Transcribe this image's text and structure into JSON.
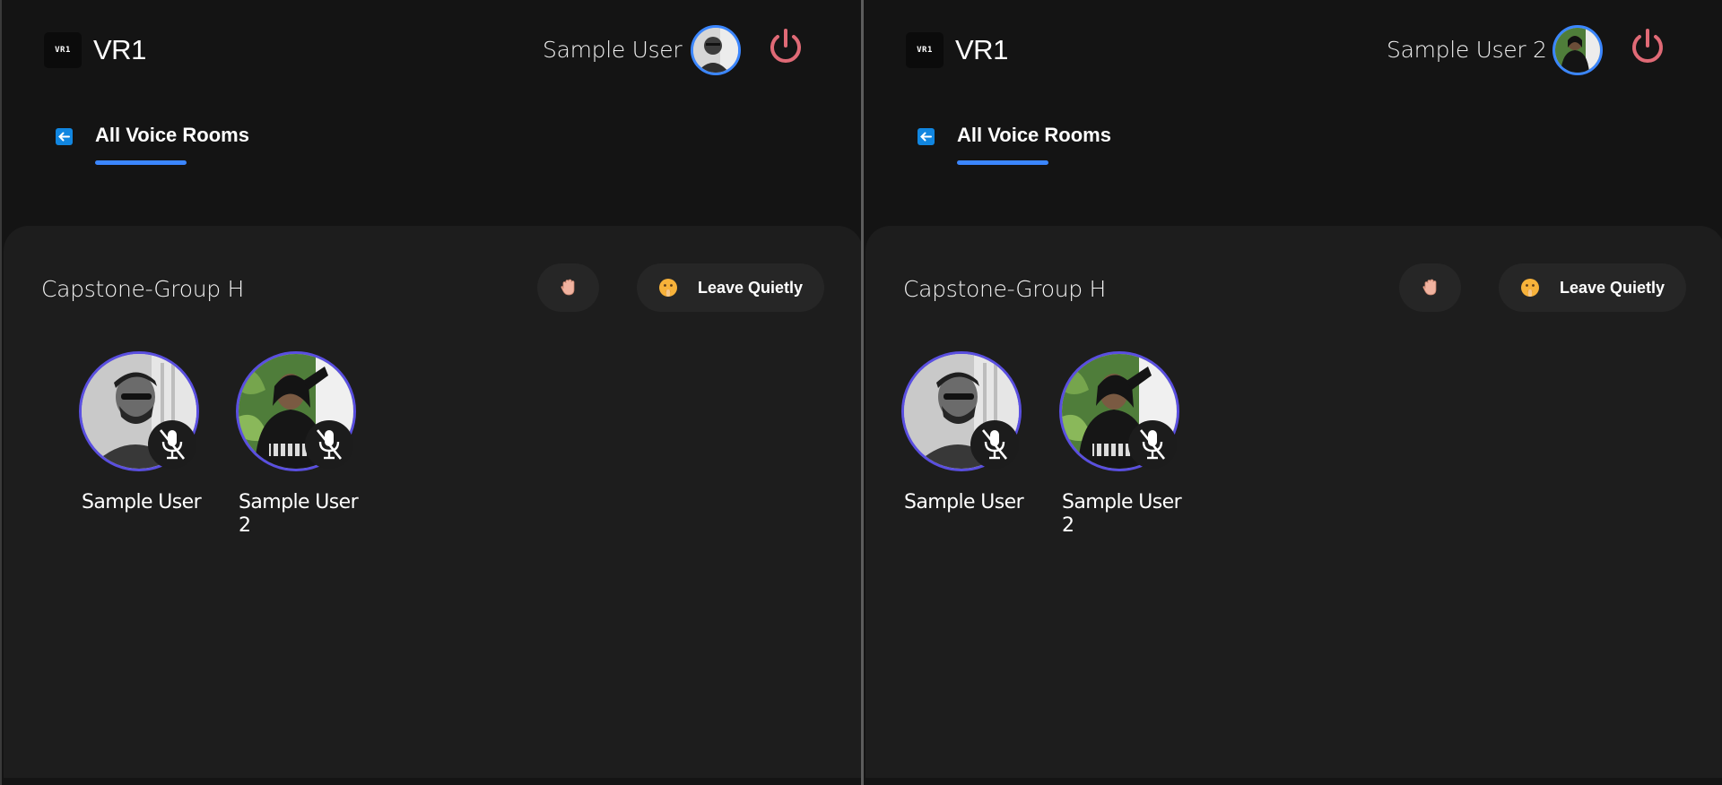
{
  "panes": [
    {
      "brand": {
        "name": "VR1",
        "logo_text": "VR1"
      },
      "current_user": {
        "name": "Sample User"
      },
      "nav": {
        "back_label": "All Voice Rooms"
      },
      "room": {
        "title": "Capstone-Group H",
        "leave_label": "Leave Quietly",
        "participants": [
          {
            "name": "Sample User",
            "muted": true
          },
          {
            "name": "Sample User 2",
            "muted": true
          }
        ]
      }
    },
    {
      "brand": {
        "name": "VR1",
        "logo_text": "VR1"
      },
      "current_user": {
        "name": "Sample User 2"
      },
      "nav": {
        "back_label": "All Voice Rooms"
      },
      "room": {
        "title": "Capstone-Group H",
        "leave_label": "Leave Quietly",
        "participants": [
          {
            "name": "Sample User",
            "muted": true
          },
          {
            "name": "Sample User 2",
            "muted": true
          }
        ]
      }
    }
  ],
  "icons": {
    "logo": "vr1-logo-icon",
    "power": "power-icon",
    "back": "arrow-left-icon",
    "raise_hand": "raised-hand-icon",
    "leave": "shushing-face-icon",
    "mic_off": "mic-off-icon"
  },
  "colors": {
    "accent": "#3b86ff",
    "power": "#e06a76",
    "avatar_ring": "#5a4fe0",
    "page_bg": "#141414",
    "card_bg": "#1d1d1d"
  }
}
